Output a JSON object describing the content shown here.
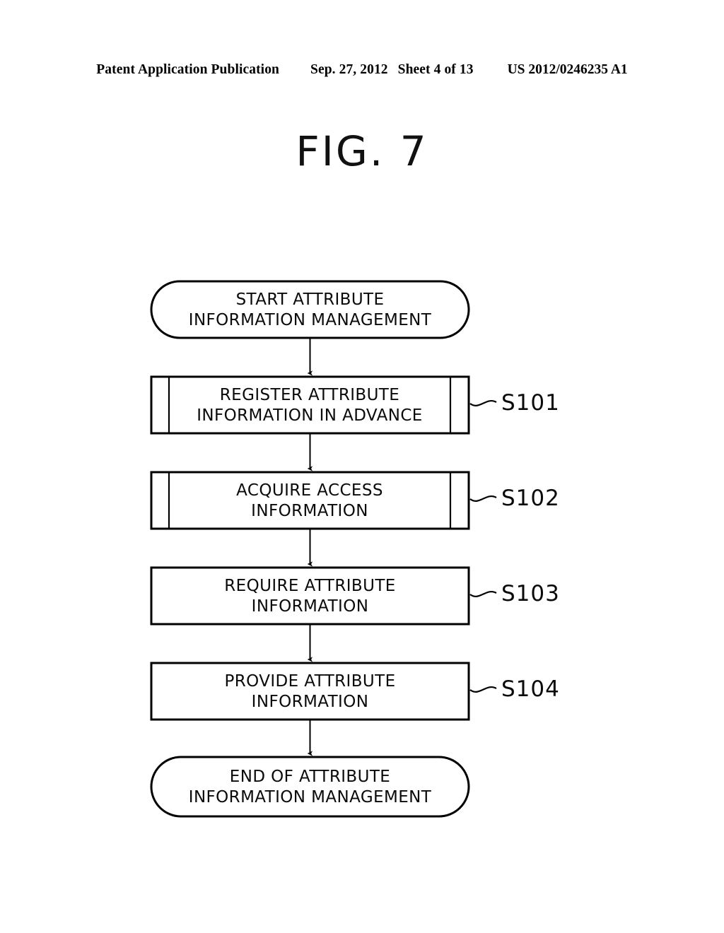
{
  "page": {
    "background": "#ffffff",
    "ink": "#000000"
  },
  "header": {
    "publication": "Patent Application Publication",
    "date": "Sep. 27, 2012",
    "sheet": "Sheet 4 of 13",
    "number": "US 2012/0246235 A1"
  },
  "figure": {
    "title": "FIG. 7"
  },
  "diagram": {
    "type": "flowchart",
    "orientation": "top-to-bottom",
    "nodes": [
      {
        "id": "start",
        "shape": "stadium",
        "lines": [
          "START ATTRIBUTE",
          "INFORMATION MANAGEMENT"
        ],
        "step": null
      },
      {
        "id": "s101",
        "shape": "predefined-process",
        "lines": [
          "REGISTER ATTRIBUTE",
          "INFORMATION IN ADVANCE"
        ],
        "step": "S101"
      },
      {
        "id": "s102",
        "shape": "predefined-process",
        "lines": [
          "ACQUIRE ACCESS",
          "INFORMATION"
        ],
        "step": "S102"
      },
      {
        "id": "s103",
        "shape": "process",
        "lines": [
          "REQUIRE ATTRIBUTE",
          "INFORMATION"
        ],
        "step": "S103"
      },
      {
        "id": "s104",
        "shape": "process",
        "lines": [
          "PROVIDE ATTRIBUTE",
          "INFORMATION"
        ],
        "step": "S104"
      },
      {
        "id": "end",
        "shape": "stadium",
        "lines": [
          "END OF ATTRIBUTE",
          "INFORMATION MANAGEMENT"
        ],
        "step": null
      }
    ],
    "edges": [
      {
        "from": "start",
        "to": "s101",
        "arrow": "down"
      },
      {
        "from": "s101",
        "to": "s102",
        "arrow": "down"
      },
      {
        "from": "s102",
        "to": "s103",
        "arrow": "down"
      },
      {
        "from": "s103",
        "to": "s104",
        "arrow": "down"
      },
      {
        "from": "s104",
        "to": "end",
        "arrow": "down"
      }
    ]
  },
  "chart_data": {
    "type": "table",
    "title": "FIG. 7",
    "categories": [
      "S101",
      "S102",
      "S103",
      "S104"
    ],
    "values": [
      "REGISTER ATTRIBUTE INFORMATION IN ADVANCE",
      "ACQUIRE ACCESS INFORMATION",
      "REQUIRE ATTRIBUTE INFORMATION",
      "PROVIDE ATTRIBUTE INFORMATION"
    ],
    "xlabel": "",
    "ylabel": ""
  }
}
